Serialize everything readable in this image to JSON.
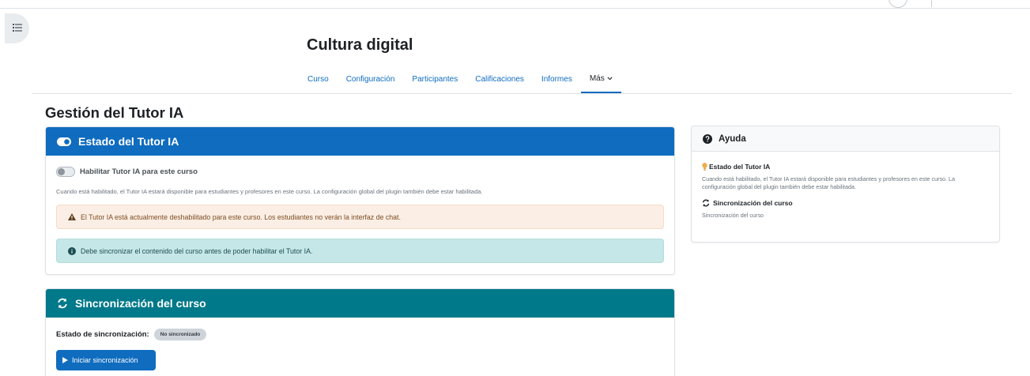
{
  "course": {
    "title": "Cultura digital"
  },
  "nav": {
    "items": [
      {
        "label": "Curso"
      },
      {
        "label": "Configuración"
      },
      {
        "label": "Participantes"
      },
      {
        "label": "Calificaciones"
      },
      {
        "label": "Informes"
      },
      {
        "label": "Más"
      }
    ],
    "active": "Más"
  },
  "page": {
    "title": "Gestión del Tutor IA"
  },
  "estado_card": {
    "header": "Estado del Tutor IA",
    "toggle_label": "Habilitar Tutor IA para este curso",
    "toggle_enabled": false,
    "help": "Cuando está habilitado, el Tutor IA estará disponible para estudiantes y profesores en este curso. La configuración global del plugin también debe estar habilitada.",
    "warning": "El Tutor IA está actualmente deshabilitado para este curso. Los estudiantes no verán la interfaz de chat.",
    "info": "Debe sincronizar el contenido del curso antes de poder habilitar el Tutor IA."
  },
  "sync_card": {
    "header": "Sincronización del curso",
    "status_label": "Estado de sincronización:",
    "status_badge": "No sincronizado",
    "start_button": "Iniciar sincronización"
  },
  "help_card": {
    "header": "Ayuda",
    "sections": [
      {
        "title": "Estado del Tutor IA",
        "text": "Cuando está habilitado, el Tutor IA estará disponible para estudiantes y profesores en este curso. La configuración global del plugin también debe estar habilitada."
      },
      {
        "title": "Sincronización del curso",
        "text": "Sincronización del curso"
      }
    ]
  },
  "colors": {
    "primary": "#0f6cbf",
    "teal": "#00798a",
    "warning_bg": "#fbeee4",
    "info_bg": "#c6e7e7",
    "bulb": "#f0ad4e"
  },
  "icons": {
    "drawer": "list-icon",
    "estado": "toggle-on-icon",
    "sync": "refresh-icon",
    "help": "question-circle-icon",
    "warning": "warning-triangle-icon",
    "info": "info-circle-icon",
    "bulb": "lightbulb-icon",
    "play": "play-icon"
  }
}
